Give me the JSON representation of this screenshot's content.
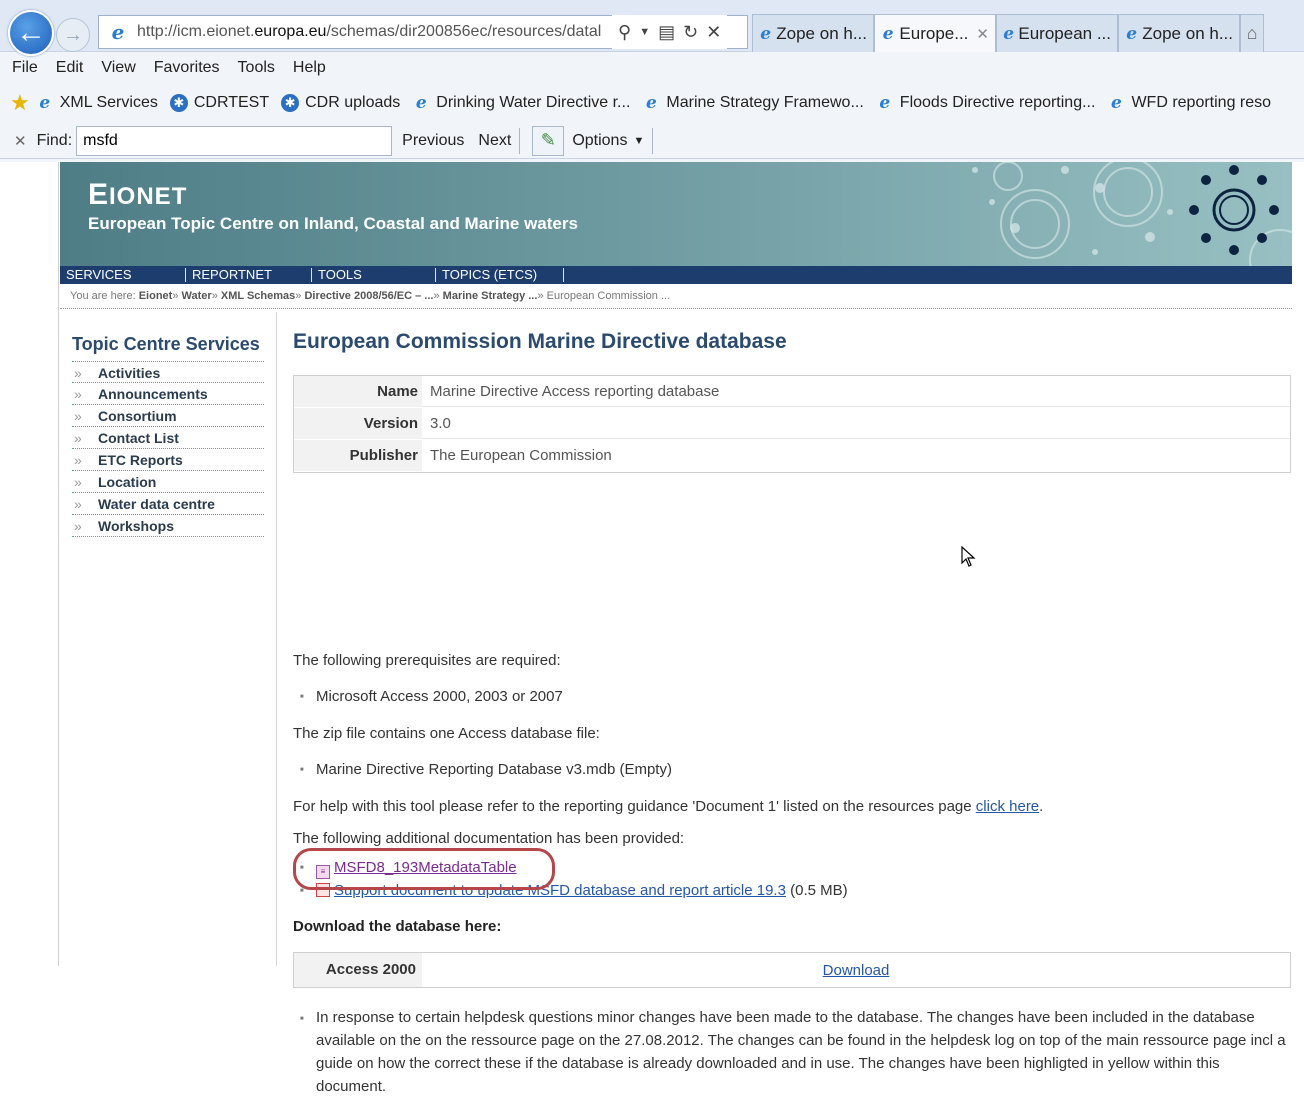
{
  "browser": {
    "back_icon": "back-arrow-icon",
    "forward_icon": "forward-arrow-icon",
    "address_url_prefix": "http://icm.eionet.",
    "address_url_domain": "europa.eu",
    "address_url_suffix": "/schemas/dir200856ec/resources/datal",
    "tabs": [
      {
        "label": "Zope on h...",
        "active": false
      },
      {
        "label": "Europe...",
        "active": true
      },
      {
        "label": "European ...",
        "active": false
      },
      {
        "label": "Zope on h...",
        "active": false
      }
    ],
    "menu": [
      "File",
      "Edit",
      "View",
      "Favorites",
      "Tools",
      "Help"
    ],
    "favorites": [
      "XML Services",
      "CDRTEST",
      "CDR uploads",
      "Drinking Water Directive r...",
      "Marine Strategy Framewo...",
      "Floods Directive reporting...",
      "WFD reporting reso"
    ],
    "find": {
      "close": "✕",
      "label": "Find:",
      "value": "msfd",
      "previous": "Previous",
      "next": "Next",
      "options": "Options"
    }
  },
  "site": {
    "title_first": "E",
    "title_rest": "IONET",
    "subtitle": "European Topic Centre on Inland, Coastal and Marine waters",
    "topnav": [
      "SERVICES",
      "REPORTNET",
      "TOOLS",
      "TOPICS (ETCS)"
    ],
    "breadcrumb": {
      "prefix": "You are here:",
      "items": [
        "Eionet",
        "Water",
        "XML Schemas",
        "Directive 2008/56/EC – ...",
        "Marine Strategy ..."
      ],
      "current": "European Commission ..."
    }
  },
  "leftnav": {
    "title": "Topic Centre Services",
    "items": [
      "Activities",
      "Announcements",
      "Consortium",
      "Contact List",
      "ETC Reports",
      "Location",
      "Water data centre",
      "Workshops"
    ]
  },
  "main": {
    "heading": "European Commission Marine Directive database",
    "meta": [
      {
        "key": "Name",
        "value": "Marine Directive Access reporting database"
      },
      {
        "key": "Version",
        "value": "3.0"
      },
      {
        "key": "Publisher",
        "value": "The European Commission"
      }
    ],
    "prereq_intro": "The following prerequisites are required:",
    "prereq_item": "Microsoft Access 2000, 2003 or 2007",
    "zip_intro": "The zip file contains one Access database file:",
    "zip_item": "Marine Directive Reporting Database v3.mdb (Empty)",
    "help_text": "For help with this tool please refer to the reporting guidance 'Document 1' listed on the resources page ",
    "help_link": "click here",
    "help_end": ".",
    "docs_intro": "The following additional documentation has been provided:",
    "doc1_link": "MSFD8_193MetadataTable",
    "doc2_link": "Support document to update MSFD database and report article 19.3",
    "doc2_size": "(0.5 MB)",
    "download_heading": "Download the database here:",
    "download_key": "Access 2000",
    "download_link": "Download",
    "note": "In response to certain helpdesk questions minor changes have been made to the database. The changes have been included in the database available on the on the ressource page on the 27.08.2012. The changes can be found in the helpdesk log on top of the main ressource page incl a guide on how the correct these if the database is already downloaded and in use. The changes have been highligted in yellow within this document."
  }
}
